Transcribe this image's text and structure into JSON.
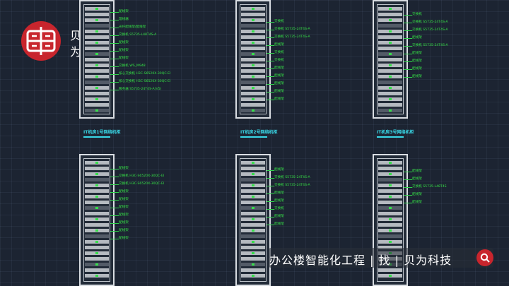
{
  "brand": {
    "name_line1": "贝",
    "name_line2": "为",
    "accent": "#c8252d"
  },
  "caption": {
    "text": "办公楼智能化工程 | 找 | 贝为科技",
    "search_icon": "search-icon"
  },
  "racks": [
    {
      "title": "IT机房1号网络机柜",
      "labels": [
        "配线架",
        "理线器",
        "光纤配线架/配线架",
        "交换机 S5735-L48T4S-A",
        "配线架",
        "配线架",
        "配线架",
        "交换机 WS_M948",
        "核心交换机 H3C-S6520X-30QC-EI",
        "核心交换机 H3C-S6520X-30QC-EI",
        "服务器 S5735-24T4S-A(V5)"
      ]
    },
    {
      "title": "IT机房2号网络机柜",
      "labels": [
        "交换机",
        "交换机 S5735-24T4S-A",
        "交换机 S5735-24T4S-A",
        "配线架",
        "交换机",
        "交换机",
        "配线架",
        "配线架",
        "配线架",
        "配线架",
        "配线架"
      ]
    },
    {
      "title": "IT机房3号网络机柜",
      "labels": [
        "交换机",
        "交换机 S5735-24T4S-A",
        "交换机 S5735-24T4S-A",
        "配线架",
        "交换机 S5735-24T4S-A",
        "配线架",
        "配线架",
        "配线架",
        "配线架"
      ]
    },
    {
      "title": "",
      "labels": [
        "配线架",
        "交换机 H3C-S6520X-30QC-EI",
        "交换机 H3C-S6520X-30QC-EI",
        "配线架",
        "配线架",
        "配线架",
        "配线架",
        "配线架",
        "配线架",
        "配线架"
      ]
    },
    {
      "title": "",
      "labels": [
        "配线架",
        "交换机 S5735-24T4S-A",
        "交换机 S5735-24T4S-A",
        "配线架",
        "配线架",
        "交换机",
        "配线架",
        "配线架"
      ]
    },
    {
      "title": "",
      "labels": [
        "配线架",
        "配线架",
        "交换机 S5735-L48T4S",
        "配线架",
        "配线架"
      ]
    }
  ]
}
